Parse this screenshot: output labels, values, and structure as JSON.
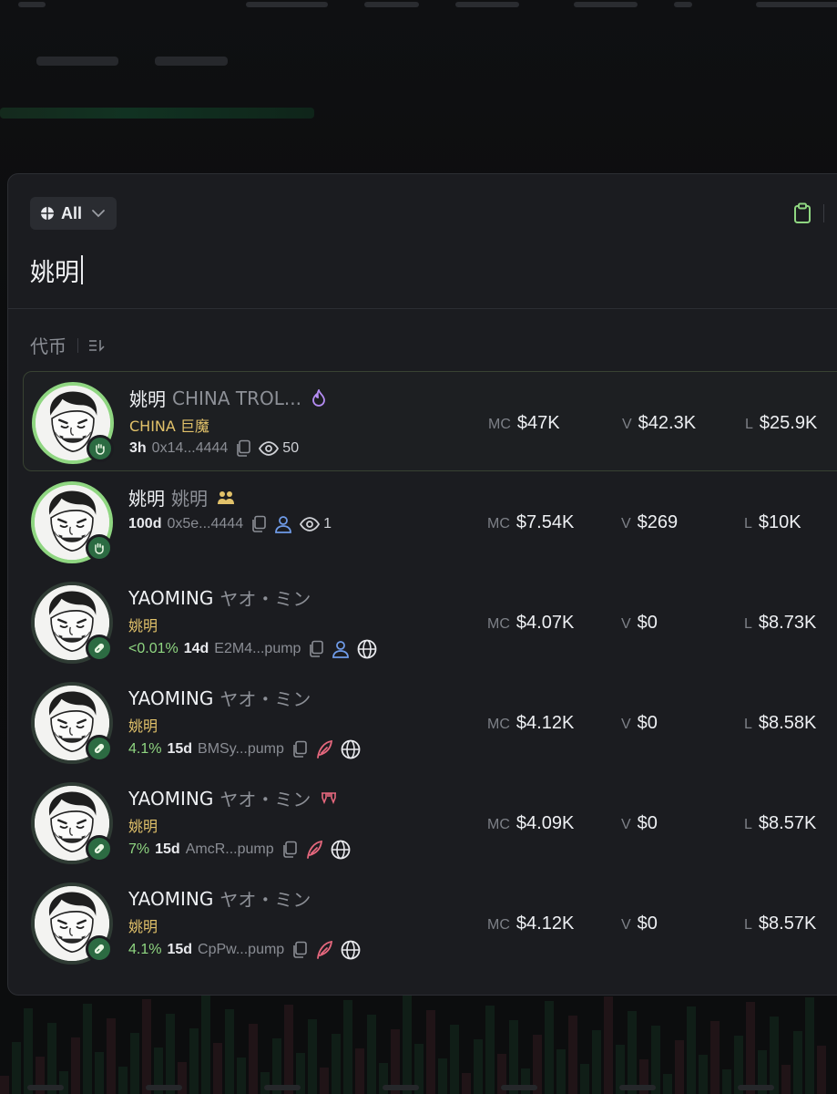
{
  "filter": {
    "label": "All",
    "icon": "globe-grid-icon"
  },
  "search": {
    "query": "姚明"
  },
  "section": {
    "title": "代币"
  },
  "colors": {
    "accent_green": "#8fd681",
    "gold": "#e2c26a",
    "panel": "#1b1c20",
    "purple": "#b48cf2",
    "blue": "#6f9be8",
    "pink": "#e5677d"
  },
  "tokens": [
    {
      "symbol": "姚明",
      "name": "CHINA TROL...",
      "name_icon": "flame-icon",
      "subtitle": "CHINA 巨魔",
      "pct": "",
      "age": "3h",
      "address": "0x14...4444",
      "meta_icons": [
        "copy-icon",
        "eye-icon"
      ],
      "views": "50",
      "mc_label": "MC",
      "mc": "$47K",
      "v_label": "V",
      "v": "$42.3K",
      "l_label": "L",
      "l": "$25.9K",
      "badge_icon": "hand-icon",
      "selected": true
    },
    {
      "symbol": "姚明",
      "name": "姚明",
      "name_icon": "people-icon",
      "subtitle": "",
      "pct": "",
      "age": "100d",
      "address": "0x5e...4444",
      "meta_icons": [
        "copy-icon",
        "user-icon",
        "eye-icon"
      ],
      "views": "1",
      "mc_label": "MC",
      "mc": "$7.54K",
      "v_label": "V",
      "v": "$269",
      "l_label": "L",
      "l": "$10K",
      "badge_icon": "hand-icon",
      "selected": false
    },
    {
      "symbol": "YAOMING",
      "name": "ヤオ・ミン",
      "name_icon": "",
      "subtitle": "姚明",
      "pct": "<0.01%",
      "age": "14d",
      "address": "E2M4...pump",
      "meta_icons": [
        "copy-icon",
        "user-icon",
        "globe-icon"
      ],
      "views": "",
      "mc_label": "MC",
      "mc": "$4.07K",
      "v_label": "V",
      "v": "$0",
      "l_label": "L",
      "l": "$8.73K",
      "badge_icon": "pill-icon",
      "selected": false
    },
    {
      "symbol": "YAOMING",
      "name": "ヤオ・ミン",
      "name_icon": "",
      "subtitle": "姚明",
      "pct": "4.1%",
      "age": "15d",
      "address": "BMSy...pump",
      "meta_icons": [
        "copy-icon",
        "feather-icon",
        "globe-icon"
      ],
      "views": "",
      "mc_label": "MC",
      "mc": "$4.12K",
      "v_label": "V",
      "v": "$0",
      "l_label": "L",
      "l": "$8.58K",
      "badge_icon": "pill-icon",
      "selected": false
    },
    {
      "symbol": "YAOMING",
      "name": "ヤオ・ミン",
      "name_icon": "fangs-icon",
      "subtitle": "姚明",
      "pct": "7%",
      "age": "15d",
      "address": "AmcR...pump",
      "meta_icons": [
        "copy-icon",
        "feather-icon",
        "globe-icon"
      ],
      "views": "",
      "mc_label": "MC",
      "mc": "$4.09K",
      "v_label": "V",
      "v": "$0",
      "l_label": "L",
      "l": "$8.57K",
      "badge_icon": "pill-icon",
      "selected": false
    },
    {
      "symbol": "YAOMING",
      "name": "ヤオ・ミン",
      "name_icon": "",
      "subtitle": "姚明",
      "pct": "4.1%",
      "age": "15d",
      "address": "CpPw...pump",
      "meta_icons": [
        "copy-icon",
        "feather-icon",
        "globe-icon"
      ],
      "views": "",
      "mc_label": "MC",
      "mc": "$4.12K",
      "v_label": "V",
      "v": "$0",
      "l_label": "L",
      "l": "$8.57K",
      "badge_icon": "pill-icon",
      "selected": false
    }
  ]
}
